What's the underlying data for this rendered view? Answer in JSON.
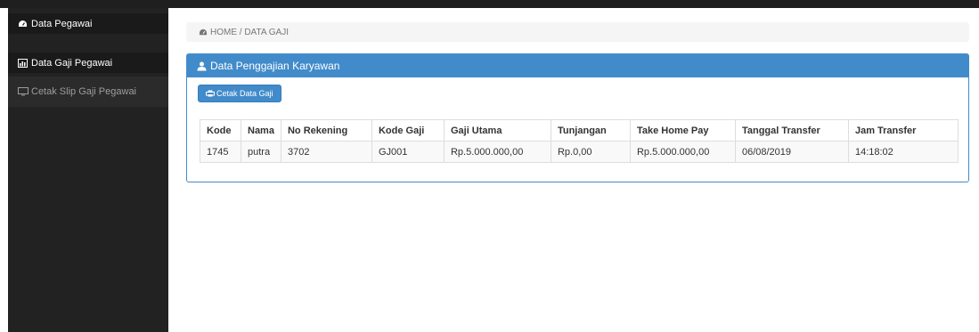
{
  "sidebar": {
    "items": [
      {
        "label": "Data Pegawai",
        "icon": "dashboard-icon"
      },
      {
        "label": "Data Gaji Pegawai",
        "icon": "bar-chart-icon"
      },
      {
        "label": "Cetak Slip Gaji Pegawai",
        "icon": "monitor-icon"
      }
    ]
  },
  "breadcrumb": {
    "text": "HOME / DATA GAJI"
  },
  "panel": {
    "title": "Data Penggajian Karyawan",
    "print_button": "Cetak Data Gaji"
  },
  "table": {
    "columns": [
      "Kode",
      "Nama",
      "No Rekening",
      "Kode Gaji",
      "Gaji Utama",
      "Tunjangan",
      "Take Home Pay",
      "Tanggal Transfer",
      "Jam Transfer"
    ],
    "rows": [
      [
        "1745",
        "putra",
        "3702",
        "GJ001",
        "Rp.5.000.000,00",
        "Rp.0,00",
        "Rp.5.000.000,00",
        "06/08/2019",
        "14:18:02"
      ]
    ]
  },
  "colors": {
    "primary": "#428bca",
    "sidebar_bg": "#222222"
  }
}
